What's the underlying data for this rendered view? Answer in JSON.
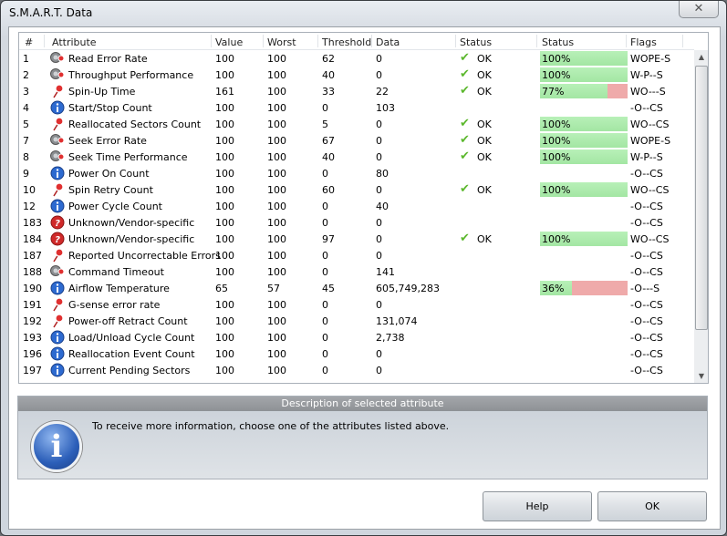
{
  "window": {
    "title": "S.M.A.R.T. Data",
    "close_icon": "close-icon"
  },
  "columns": [
    "#",
    "Attribute",
    "Value",
    "Worst",
    "Threshold",
    "Data",
    "Status",
    "Status",
    "Flags"
  ],
  "rows": [
    {
      "id": "1",
      "icon": "gauge",
      "name": "Read Error Rate",
      "value": "100",
      "worst": "100",
      "threshold": "62",
      "data": "0",
      "status": "OK",
      "health": 100,
      "health_label": "100%",
      "flags": "WOPE-S"
    },
    {
      "id": "2",
      "icon": "gauge",
      "name": "Throughput Performance",
      "value": "100",
      "worst": "100",
      "threshold": "40",
      "data": "0",
      "status": "OK",
      "health": 100,
      "health_label": "100%",
      "flags": "W-P--S"
    },
    {
      "id": "3",
      "icon": "pin",
      "name": "Spin-Up Time",
      "value": "161",
      "worst": "100",
      "threshold": "33",
      "data": "22",
      "status": "OK",
      "health": 77,
      "health_label": "77%",
      "flags": "WO---S"
    },
    {
      "id": "4",
      "icon": "info",
      "name": "Start/Stop Count",
      "value": "100",
      "worst": "100",
      "threshold": "0",
      "data": "103",
      "status": "",
      "health": null,
      "health_label": "",
      "flags": "-O--CS"
    },
    {
      "id": "5",
      "icon": "pin",
      "name": "Reallocated Sectors Count",
      "value": "100",
      "worst": "100",
      "threshold": "5",
      "data": "0",
      "status": "OK",
      "health": 100,
      "health_label": "100%",
      "flags": "WO--CS"
    },
    {
      "id": "7",
      "icon": "gauge",
      "name": "Seek Error Rate",
      "value": "100",
      "worst": "100",
      "threshold": "67",
      "data": "0",
      "status": "OK",
      "health": 100,
      "health_label": "100%",
      "flags": "WOPE-S"
    },
    {
      "id": "8",
      "icon": "gauge",
      "name": "Seek Time Performance",
      "value": "100",
      "worst": "100",
      "threshold": "40",
      "data": "0",
      "status": "OK",
      "health": 100,
      "health_label": "100%",
      "flags": "W-P--S"
    },
    {
      "id": "9",
      "icon": "info",
      "name": "Power On Count",
      "value": "100",
      "worst": "100",
      "threshold": "0",
      "data": "80",
      "status": "",
      "health": null,
      "health_label": "",
      "flags": "-O--CS"
    },
    {
      "id": "10",
      "icon": "pin",
      "name": "Spin Retry Count",
      "value": "100",
      "worst": "100",
      "threshold": "60",
      "data": "0",
      "status": "OK",
      "health": 100,
      "health_label": "100%",
      "flags": "WO--CS"
    },
    {
      "id": "12",
      "icon": "info",
      "name": "Power Cycle Count",
      "value": "100",
      "worst": "100",
      "threshold": "0",
      "data": "40",
      "status": "",
      "health": null,
      "health_label": "",
      "flags": "-O--CS"
    },
    {
      "id": "183",
      "icon": "question",
      "name": "Unknown/Vendor-specific",
      "value": "100",
      "worst": "100",
      "threshold": "0",
      "data": "0",
      "status": "",
      "health": null,
      "health_label": "",
      "flags": "-O--CS"
    },
    {
      "id": "184",
      "icon": "question",
      "name": "Unknown/Vendor-specific",
      "value": "100",
      "worst": "100",
      "threshold": "97",
      "data": "0",
      "status": "OK",
      "health": 100,
      "health_label": "100%",
      "flags": "WO--CS"
    },
    {
      "id": "187",
      "icon": "pin",
      "name": "Reported Uncorrectable Errors",
      "value": "100",
      "worst": "100",
      "threshold": "0",
      "data": "0",
      "status": "",
      "health": null,
      "health_label": "",
      "flags": "-O--CS"
    },
    {
      "id": "188",
      "icon": "gauge",
      "name": "Command Timeout",
      "value": "100",
      "worst": "100",
      "threshold": "0",
      "data": "141",
      "status": "",
      "health": null,
      "health_label": "",
      "flags": "-O--CS"
    },
    {
      "id": "190",
      "icon": "info",
      "name": "Airflow Temperature",
      "value": "65",
      "worst": "57",
      "threshold": "45",
      "data": "605,749,283",
      "status": "",
      "health": 36,
      "health_label": "36%",
      "flags": "-O---S"
    },
    {
      "id": "191",
      "icon": "pin",
      "name": "G-sense error rate",
      "value": "100",
      "worst": "100",
      "threshold": "0",
      "data": "0",
      "status": "",
      "health": null,
      "health_label": "",
      "flags": "-O--CS"
    },
    {
      "id": "192",
      "icon": "pin",
      "name": "Power-off Retract Count",
      "value": "100",
      "worst": "100",
      "threshold": "0",
      "data": "131,074",
      "status": "",
      "health": null,
      "health_label": "",
      "flags": "-O--CS"
    },
    {
      "id": "193",
      "icon": "info",
      "name": "Load/Unload Cycle Count",
      "value": "100",
      "worst": "100",
      "threshold": "0",
      "data": "2,738",
      "status": "",
      "health": null,
      "health_label": "",
      "flags": "-O--CS"
    },
    {
      "id": "196",
      "icon": "info",
      "name": "Reallocation Event Count",
      "value": "100",
      "worst": "100",
      "threshold": "0",
      "data": "0",
      "status": "",
      "health": null,
      "health_label": "",
      "flags": "-O--CS"
    },
    {
      "id": "197",
      "icon": "info",
      "name": "Current Pending Sectors",
      "value": "100",
      "worst": "100",
      "threshold": "0",
      "data": "0",
      "status": "",
      "health": null,
      "health_label": "",
      "flags": "-O--CS"
    }
  ],
  "description": {
    "header": "Description of selected attribute",
    "text": "To receive more information, choose one of the attributes listed above."
  },
  "buttons": {
    "help": "Help",
    "ok": "OK"
  },
  "colors": {
    "good": "#a8e8a8",
    "bad": "#efaaaa",
    "check": "#5cb82e"
  }
}
